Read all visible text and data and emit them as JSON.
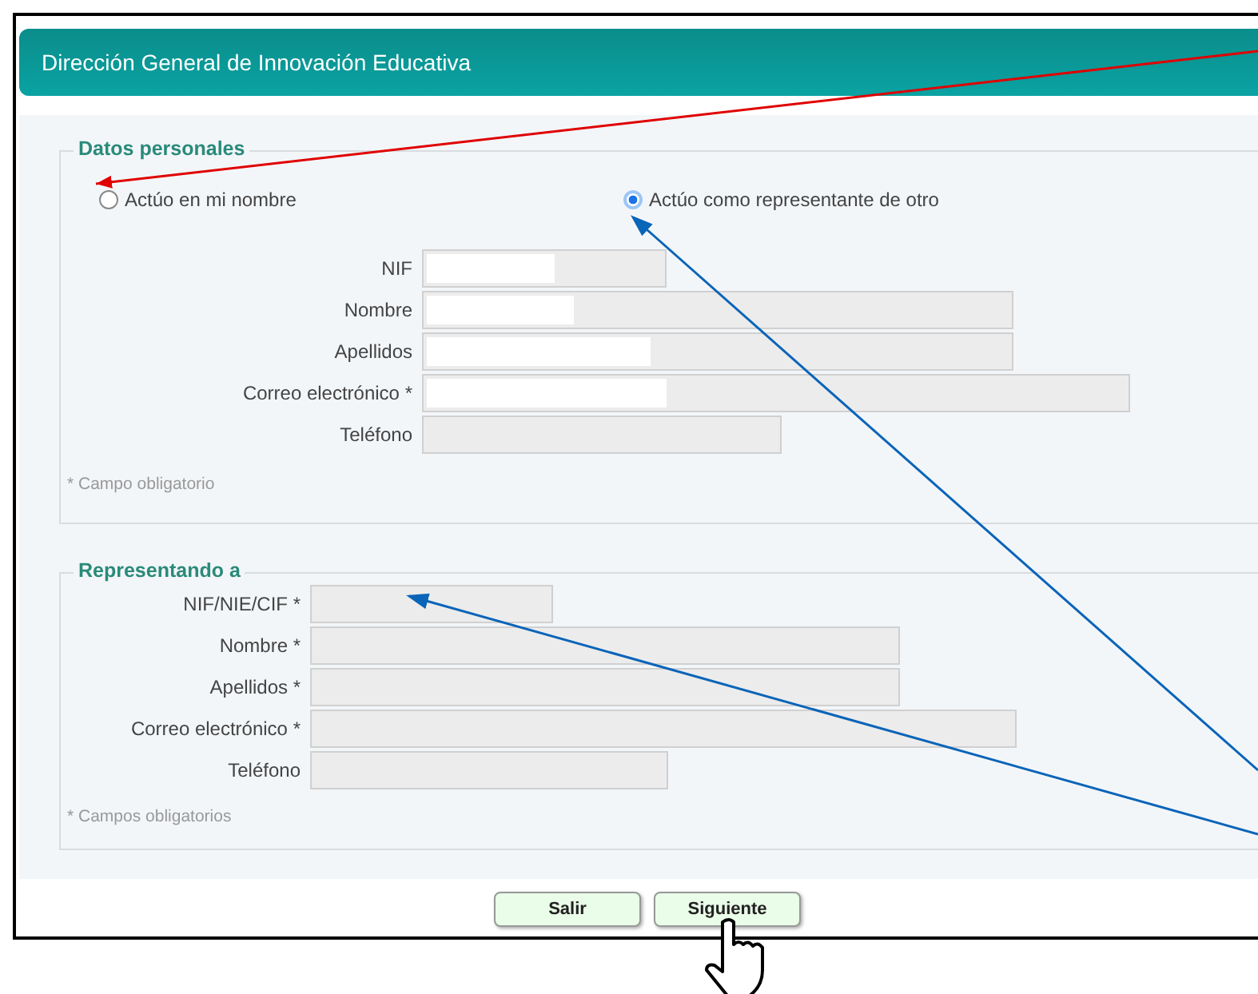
{
  "header": {
    "title": "Dirección General de Innovación Educativa"
  },
  "sections": [
    {
      "legend": "Datos personales",
      "radios": [
        {
          "label": "Actúo en mi nombre",
          "selected": false
        },
        {
          "label": "Actúo como representante de otro",
          "selected": true
        }
      ],
      "fields": [
        {
          "label": "NIF",
          "redacted": true
        },
        {
          "label": "Nombre",
          "redacted": true
        },
        {
          "label": "Apellidos",
          "redacted": true
        },
        {
          "label": "Correo electrónico *",
          "redacted": true
        },
        {
          "label": "Teléfono",
          "redacted": false
        }
      ],
      "note": "* Campo obligatorio"
    },
    {
      "legend": "Representando a",
      "fields": [
        {
          "label": "NIF/NIE/CIF *",
          "redacted": false
        },
        {
          "label": "Nombre *",
          "redacted": false
        },
        {
          "label": "Apellidos *",
          "redacted": false
        },
        {
          "label": "Correo electrónico *",
          "redacted": false
        },
        {
          "label": "Teléfono",
          "redacted": false
        }
      ],
      "note": "* Campos obligatorios"
    }
  ],
  "buttons": [
    "Salir",
    "Siguiente"
  ]
}
